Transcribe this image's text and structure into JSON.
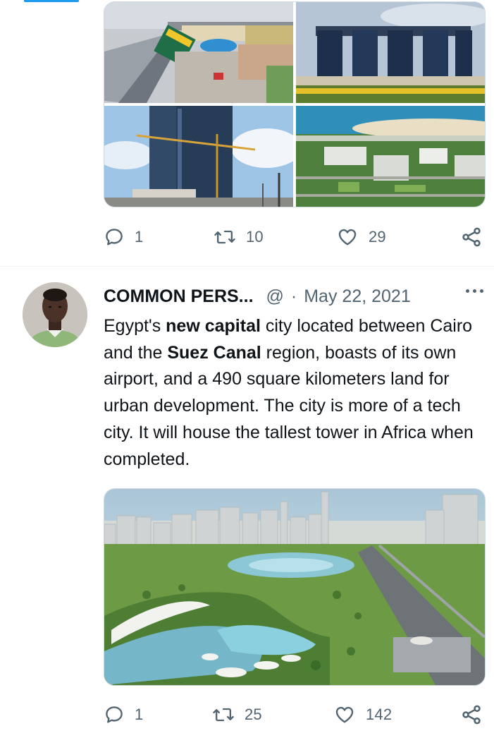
{
  "tweet_prev": {
    "images": [
      {
        "alt": "monorail-station-image"
      },
      {
        "alt": "bridge-tower-hotel-image"
      },
      {
        "alt": "skyscraper-construction-image"
      },
      {
        "alt": "aerial-complex-image"
      }
    ],
    "actions": {
      "reply_count": "1",
      "retweet_count": "10",
      "like_count": "29"
    }
  },
  "tweet": {
    "author": "COMMON PERS...",
    "handle": "@",
    "separator": "·",
    "date": "May 22, 2021",
    "text": {
      "t1": "Egypt's ",
      "b1": "new capital",
      "t2": " city located between Cairo and the ",
      "b2": "Suez Canal",
      "t3": " region, boasts of its own airport, and a 490 square kilometers land for urban development. The city is more of a tech city. It will house the tallest tower in Africa when completed."
    },
    "actions": {
      "reply_count": "1",
      "retweet_count": "25",
      "like_count": "142"
    }
  },
  "icons": {
    "reply": "reply-icon",
    "retweet": "retweet-icon",
    "like": "heart-icon",
    "share": "share-icon",
    "more": "more-icon"
  },
  "colors": {
    "text": "#0f1419",
    "secondary": "#536471",
    "accent": "#1d9bf0",
    "border": "#cfd9de"
  }
}
